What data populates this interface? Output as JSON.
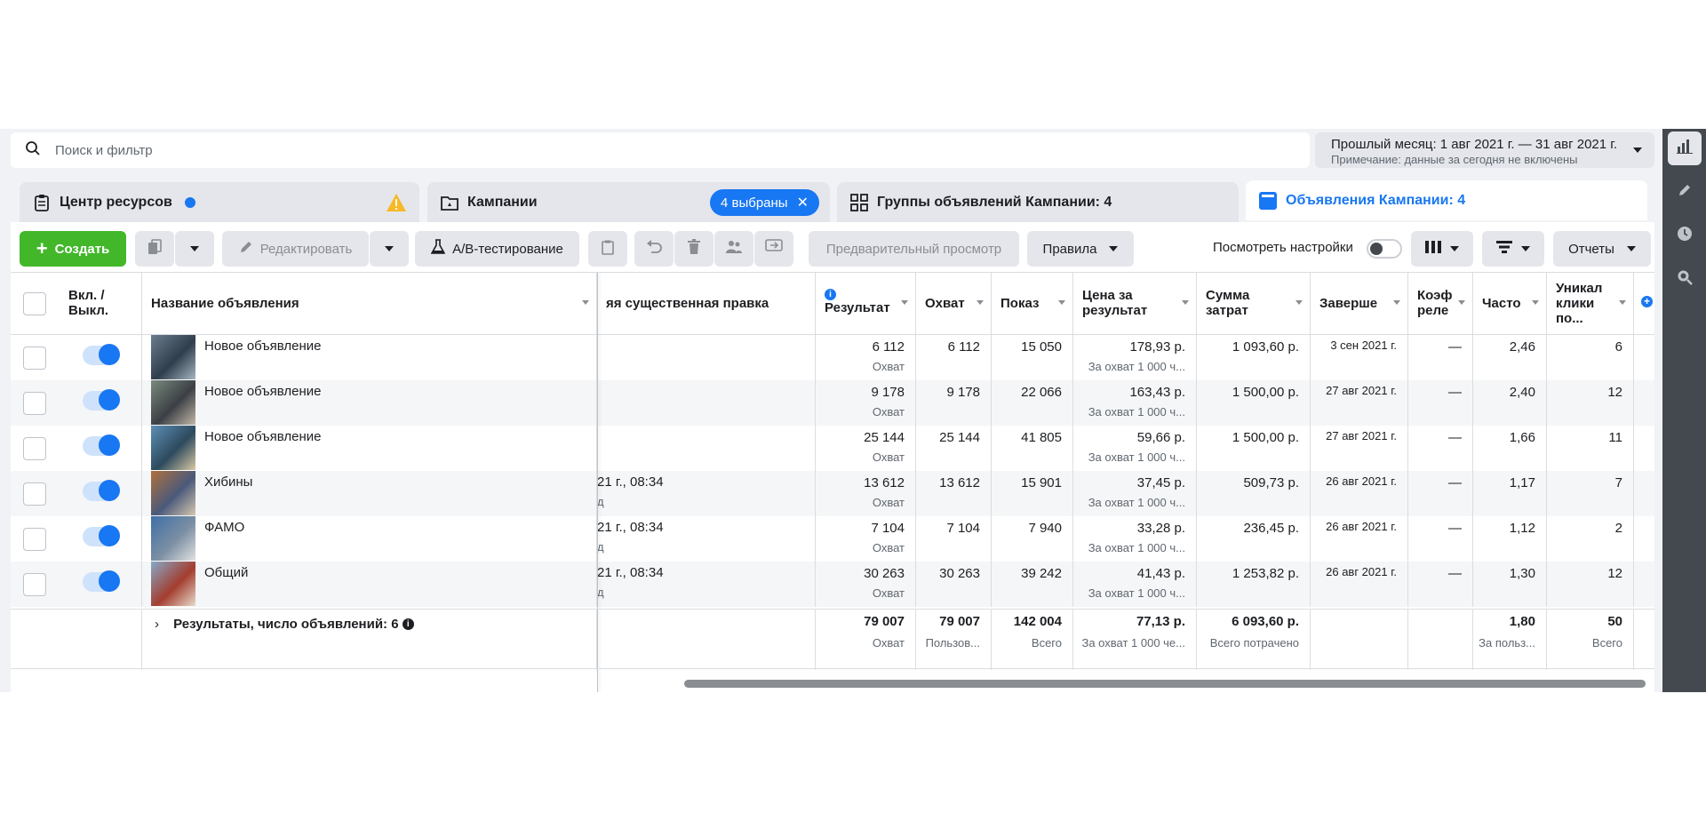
{
  "search": {
    "placeholder": "Поиск и фильтр"
  },
  "date_range": {
    "label": "Прошлый месяц: 1 авг 2021 г. — 31 авг 2021 г.",
    "note": "Примечание: данные за сегодня не включены"
  },
  "tabs": [
    {
      "label": "Центр ресурсов"
    },
    {
      "label": "Кампании",
      "chip": "4 выбраны"
    },
    {
      "label": "Группы объявлений Кампании: 4"
    },
    {
      "label": "Объявления Кампании: 4"
    }
  ],
  "toolbar": {
    "create": "Создать",
    "edit": "Редактировать",
    "ab_test": "A/B-тестирование",
    "preview": "Предварительный просмотр",
    "rules": "Правила",
    "view_settings": "Посмотреть настройки",
    "reports": "Отчеты"
  },
  "columns": {
    "onoff": "Вкл. / Выкл.",
    "name": "Название объявления",
    "last_edit": "яя существенная правка",
    "result": "Результат",
    "reach": "Охват",
    "impressions": "Показ",
    "cost_per_result": "Цена за результат",
    "spend": "Сумма затрат",
    "ends": "Заверше",
    "relevance": "Коэф реле",
    "frequency": "Часто",
    "unique_clicks": "Уникал клики по..."
  },
  "rows": [
    {
      "name": "Новое объявление",
      "edit_date": "",
      "edit_sub": "",
      "result": "6 112",
      "result_sub": "Охват",
      "reach": "6 112",
      "impressions": "15 050",
      "cpr": "178,93 р.",
      "cpr_sub": "За охват 1 000 ч...",
      "spend": "1 093,60 р.",
      "ends": "3 сен 2021 г.",
      "relevance": "—",
      "frequency": "2,46",
      "clicks": "6"
    },
    {
      "name": "Новое объявление",
      "edit_date": "",
      "edit_sub": "",
      "result": "9 178",
      "result_sub": "Охват",
      "reach": "9 178",
      "impressions": "22 066",
      "cpr": "163,43 р.",
      "cpr_sub": "За охват 1 000 ч...",
      "spend": "1 500,00 р.",
      "ends": "27 авг 2021 г.",
      "relevance": "—",
      "frequency": "2,40",
      "clicks": "12"
    },
    {
      "name": "Новое объявление",
      "edit_date": "",
      "edit_sub": "",
      "result": "25 144",
      "result_sub": "Охват",
      "reach": "25 144",
      "impressions": "41 805",
      "cpr": "59,66 р.",
      "cpr_sub": "За охват 1 000 ч...",
      "spend": "1 500,00 р.",
      "ends": "27 авг 2021 г.",
      "relevance": "—",
      "frequency": "1,66",
      "clicks": "11"
    },
    {
      "name": "Хибины",
      "edit_date": "21 г., 08:34",
      "edit_sub": "д",
      "result": "13 612",
      "result_sub": "Охват",
      "reach": "13 612",
      "impressions": "15 901",
      "cpr": "37,45 р.",
      "cpr_sub": "За охват 1 000 ч...",
      "spend": "509,73 р.",
      "ends": "26 авг 2021 г.",
      "relevance": "—",
      "frequency": "1,17",
      "clicks": "7"
    },
    {
      "name": "ФАМО",
      "edit_date": "21 г., 08:34",
      "edit_sub": "д",
      "result": "7 104",
      "result_sub": "Охват",
      "reach": "7 104",
      "impressions": "7 940",
      "cpr": "33,28 р.",
      "cpr_sub": "За охват 1 000 ч...",
      "spend": "236,45 р.",
      "ends": "26 авг 2021 г.",
      "relevance": "—",
      "frequency": "1,12",
      "clicks": "2"
    },
    {
      "name": "Общий",
      "edit_date": "21 г., 08:34",
      "edit_sub": "д",
      "result": "30 263",
      "result_sub": "Охват",
      "reach": "30 263",
      "impressions": "39 242",
      "cpr": "41,43 р.",
      "cpr_sub": "За охват 1 000 ч...",
      "spend": "1 253,82 р.",
      "ends": "26 авг 2021 г.",
      "relevance": "—",
      "frequency": "1,30",
      "clicks": "12"
    }
  ],
  "totals": {
    "label": "Результаты, число объявлений: 6",
    "result": "79 007",
    "result_sub": "Охват",
    "reach": "79 007",
    "reach_sub": "Пользов...",
    "impressions": "142 004",
    "impressions_sub": "Всего",
    "cpr": "77,13 р.",
    "cpr_sub": "За охват 1 000 че...",
    "spend": "6 093,60 р.",
    "spend_sub": "Всего потрачено",
    "frequency": "1,80",
    "frequency_sub": "За польз...",
    "clicks": "50",
    "clicks_sub": "Всего"
  },
  "colors": {
    "accent": "#1877f2",
    "create": "#42b72a",
    "warning": "#f7b928"
  },
  "icons": [
    "search-icon",
    "clipboard-icon",
    "warning-icon",
    "folder-icon",
    "grid-icon",
    "ad-icon",
    "plus-icon",
    "duplicate-icon",
    "pencil-icon",
    "flask-icon",
    "undo-icon",
    "trash-icon",
    "people-icon",
    "swap-icon",
    "columns-icon",
    "breakdown-icon",
    "chart-icon",
    "clock-icon",
    "search-zoom-icon",
    "info-icon",
    "chevron-right-icon"
  ]
}
